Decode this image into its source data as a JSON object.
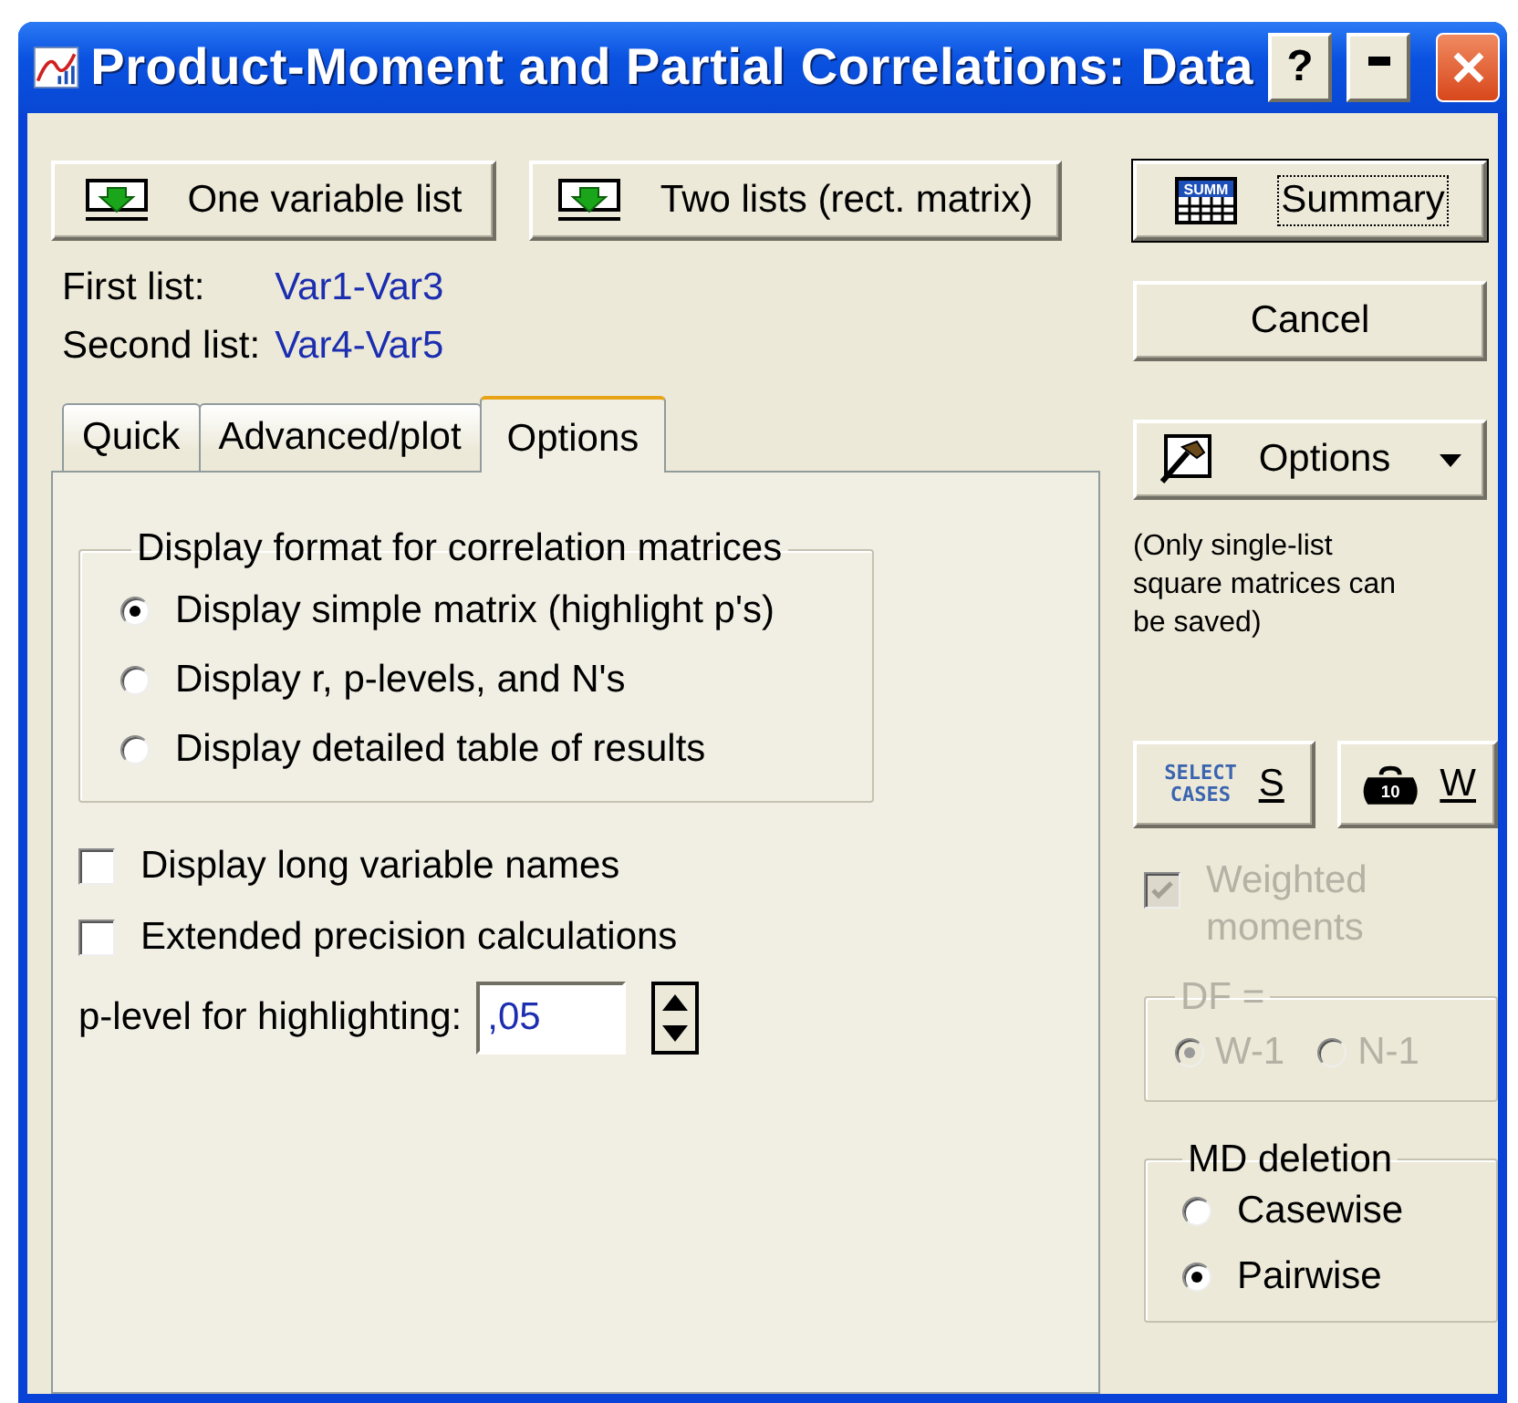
{
  "window": {
    "title": "Product-Moment and Partial Correlations: Data",
    "help": "?"
  },
  "list_buttons": [
    {
      "label": "One variable list"
    },
    {
      "label": "Two lists (rect. matrix)"
    }
  ],
  "lists": [
    {
      "label": "First list:",
      "value": "Var1-Var3"
    },
    {
      "label": "Second list:",
      "value": "Var4-Var5"
    }
  ],
  "tabs": [
    {
      "label": "Quick",
      "selected": false
    },
    {
      "label": "Advanced/plot",
      "selected": false
    },
    {
      "label": "Options",
      "selected": true
    }
  ],
  "display_format": {
    "title": "Display format for correlation matrices",
    "options": [
      {
        "label": "Display simple matrix (highlight p's)",
        "selected": true
      },
      {
        "label": "Display r, p-levels, and N's",
        "selected": false
      },
      {
        "label": "Display detailed table of results",
        "selected": false
      }
    ]
  },
  "checkboxes": [
    {
      "label": "Display long variable names",
      "checked": false
    },
    {
      "label": "Extended precision calculations",
      "checked": false
    }
  ],
  "p_level": {
    "label": "p-level for highlighting:",
    "value": ",05"
  },
  "side": {
    "summary": {
      "label": "Summary",
      "icon_text": "SUMM"
    },
    "cancel": "Cancel",
    "options": "Options",
    "note": "(Only single-list square matrices can be saved)",
    "select_cases": {
      "icon_text": "SELECT CASES",
      "key": "S"
    },
    "weight": {
      "icon_text": "10",
      "key": "W"
    },
    "weighted": {
      "label": "Weighted moments",
      "checked": true,
      "disabled": true
    },
    "df": {
      "title": "DF =",
      "disabled": true,
      "options": [
        {
          "label": "W-1",
          "selected": true
        },
        {
          "label": "N-1",
          "selected": false
        }
      ]
    },
    "md_deletion": {
      "title": "MD deletion",
      "options": [
        {
          "label": "Casewise",
          "selected": false
        },
        {
          "label": "Pairwise",
          "selected": true
        }
      ]
    }
  }
}
